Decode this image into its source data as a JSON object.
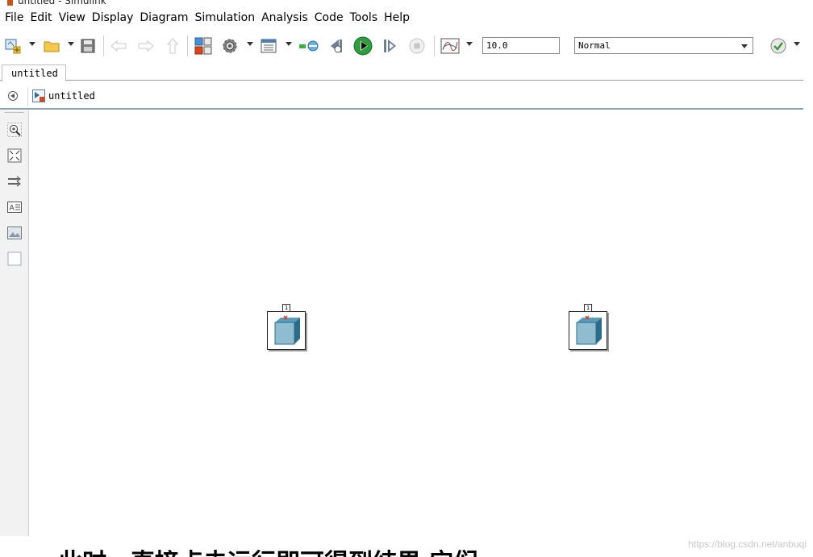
{
  "window": {
    "title": "untitled - Simulink"
  },
  "menu": [
    "File",
    "Edit",
    "View",
    "Display",
    "Diagram",
    "Simulation",
    "Analysis",
    "Code",
    "Tools",
    "Help"
  ],
  "toolbar": {
    "stop_time": "10.0",
    "sim_mode": "Normal",
    "icons": [
      "new-model-icon",
      "open-folder-icon",
      "save-icon",
      "back-arrow-icon",
      "forward-arrow-icon",
      "up-arrow-icon",
      "library-browser-icon",
      "model-settings-icon",
      "model-explorer-icon",
      "signal-logging-icon",
      "step-back-icon",
      "run-icon",
      "step-forward-icon",
      "stop-icon",
      "scope-icon",
      "check-model-icon"
    ]
  },
  "tabs": [
    {
      "label": "untitled"
    }
  ],
  "breadcrumb": {
    "label": "untitled"
  },
  "palette": [
    "zoom-in-icon",
    "fit-to-view-icon",
    "signal-route-icon",
    "annotation-icon",
    "image-icon",
    "area-icon"
  ],
  "canvas": {
    "blocks": [
      {
        "name": "subsystem-block-1",
        "port_number": "1"
      },
      {
        "name": "subsystem-block-2",
        "port_number": "1"
      }
    ]
  },
  "overlay": {
    "cut_text": "此时，直接点击运行即可得到结果 它们",
    "watermark": "https://blog.csdn.net/anbuqi"
  },
  "colors": {
    "run_green": "#2e9e3e",
    "block_cube": "#8fbccf",
    "block_cube_dark": "#2c6b8a",
    "canvas": "#ffffff",
    "palette_bg": "#f2f2f2"
  }
}
